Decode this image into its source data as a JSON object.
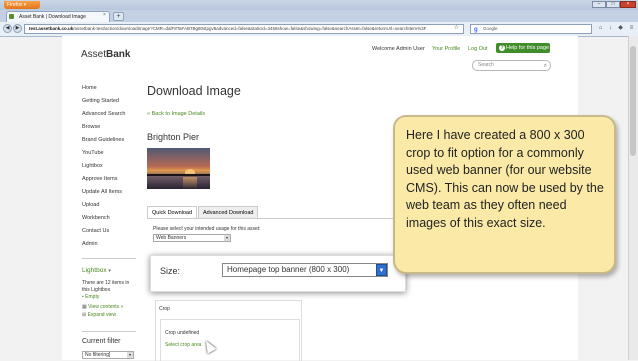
{
  "browser": {
    "menu_button": "Firefox",
    "tab_title": "Asset Bank | Download Image",
    "tab_close": "×",
    "new_tab": "+",
    "url_domain": "test.assetbank.co.uk",
    "url_path": "/assetbank-test/action/downloadImage?CMR=dalF8TaFAB7Bg80stpgv8advanced=false&staticid=3458show=false&showing=false&searchAsset=false&returnUrl=searchItem%3F",
    "search_engine_glyph": "g",
    "search_placeholder": "Google"
  },
  "header": {
    "logo_asset": "Asset",
    "logo_bank": "Bank",
    "welcome": "Welcome Admin User",
    "your_profile": "Your Profile",
    "log_out": "Log Out",
    "help_icon": "?",
    "help": "Help for this page",
    "search_placeholder": "Search"
  },
  "sidebar": {
    "items": [
      "Home",
      "Getting Started",
      "Advanced Search",
      "Browse",
      "Brand Guidelines",
      "YouTube",
      "Lightbox",
      "Approve Items",
      "Update All Items",
      "Upload",
      "Workbench",
      "Contact Us",
      "Admin"
    ],
    "lightbox_title": "Lightbox",
    "lightbox_count_text": "There are 12 items in this Lightbox",
    "lightbox_empty": "Empty",
    "lightbox_view_contents": "View contents »",
    "lightbox_expand": "Expand view",
    "current_filter": "Current filter",
    "filter_value": "No filtering]"
  },
  "main": {
    "title": "Download Image",
    "back_link": "« Back to Image Details",
    "image_title": "Brighton Pier",
    "tab_quick": "Quick Download",
    "tab_advanced": "Advanced Download",
    "usage_prompt": "Please select your intended usage for this asset:",
    "usage_value": "Web Banners",
    "size_label": "Size:",
    "size_value": "Homepage top banner (800 x 300)",
    "crop_tab": "Crop",
    "crop_status": "Crop undefined",
    "crop_link": "Select crop area"
  },
  "callout": {
    "text": "Here I have created a 800 x 300 crop to fit option for a commonly used web banner (for our website CMS). This can now be used by the web team as they often need images of this exact size."
  }
}
